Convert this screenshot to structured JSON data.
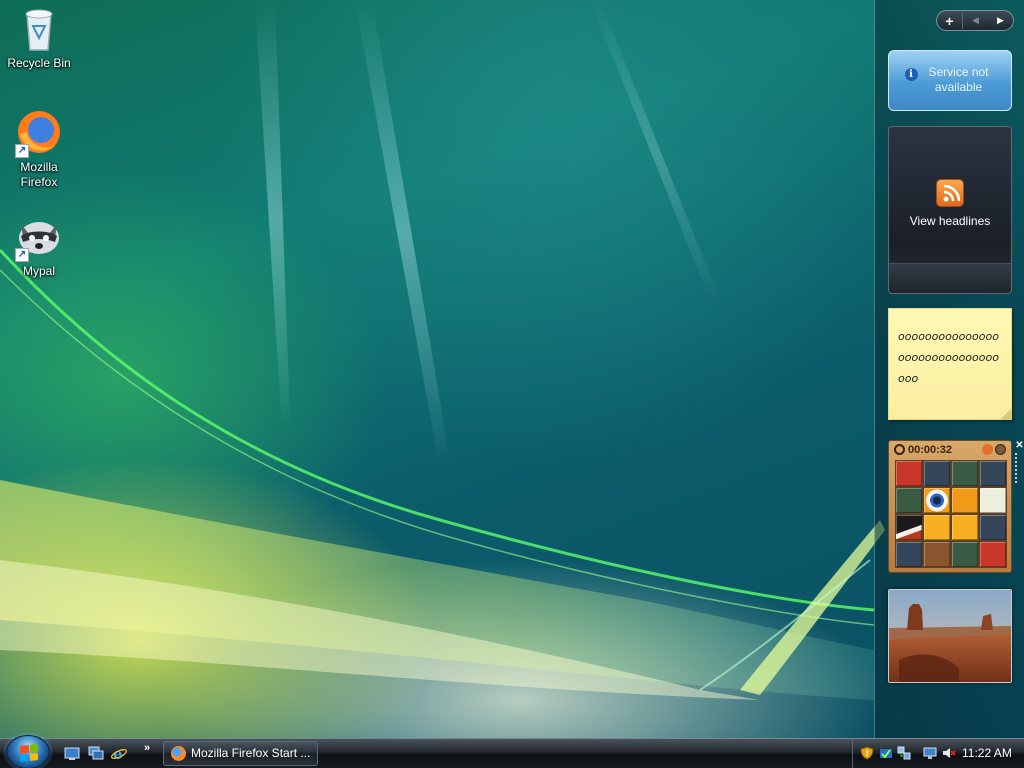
{
  "desktop": {
    "icons": [
      {
        "label": "Recycle Bin"
      },
      {
        "label": "Mozilla Firefox"
      },
      {
        "label": "Mypal"
      }
    ]
  },
  "sidebar": {
    "toolbar": {
      "add_icon": "plus-icon",
      "prev_icon": "left-arrow-icon",
      "next_icon": "right-arrow-icon"
    },
    "weather": {
      "message": "Service not available",
      "icon": "info-icon"
    },
    "feed": {
      "label": "View headlines",
      "icon": "rss-icon"
    },
    "notes": {
      "text": "ooooooooooooooooooooooooooooooooo"
    },
    "puzzle": {
      "timer": "00:00:32",
      "tile_colors": [
        "#c9372a",
        "#36465a",
        "#3b5a44",
        "#36465a",
        "#3b5a44",
        "#ffffff-eye",
        "#f29a1a",
        "#eeeedd",
        "#1b1b1b-beak",
        "#f7b021",
        "#f7b021",
        "#36465a",
        "#36465a",
        "#8a5530",
        "#3b5a44",
        "#c9372a"
      ]
    },
    "slideshow": {
      "image": "desert-mesa-photo"
    },
    "gadget_controls": {
      "close_icon": "close-icon",
      "drag_icon": "drag-handle-icon"
    }
  },
  "taskbar": {
    "start_icon": "windows-start-orb",
    "quick_launch": [
      "show-desktop-icon",
      "switch-windows-icon",
      "internet-explorer-icon"
    ],
    "quick_launch_more": "»",
    "task_button": {
      "label": "Mozilla Firefox Start ...",
      "icon": "firefox-icon"
    },
    "tray_icons": [
      "security-shield-icon",
      "windows-update-icon",
      "network-icon",
      "monitor-icon",
      "volume-muted-icon"
    ],
    "clock": "11:22 AM"
  },
  "colors": {
    "accent": "#3a86c8",
    "sticky_note": "#fbeea0",
    "weather_blue": "#4c9bd6"
  }
}
